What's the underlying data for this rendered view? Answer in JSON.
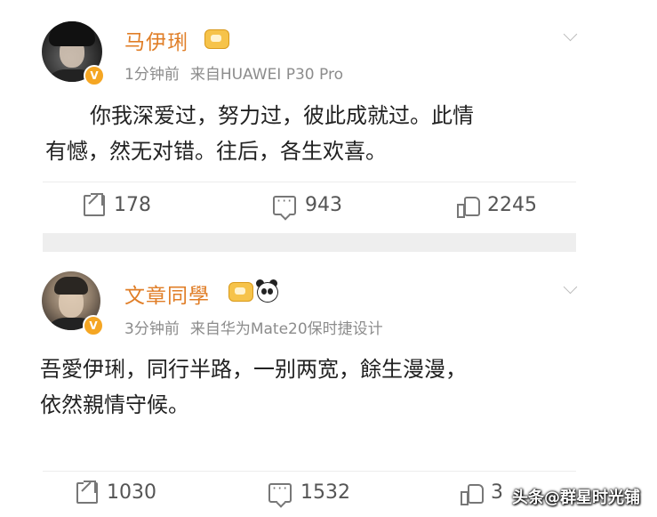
{
  "posts": [
    {
      "username": "马伊琍",
      "time": "1分钟前",
      "source": "来自HUAWEI P30 Pro",
      "content_lines": [
        "你我深爱过，努力过，彼此成就过。此情",
        "有憾，然无对错。往后，各生欢喜。"
      ],
      "reposts": "178",
      "comments": "943",
      "likes": "2245",
      "badge": "V"
    },
    {
      "username": "文章同學",
      "time": "3分钟前",
      "source": "来自华为Mate20保时捷设计",
      "content_lines": [
        "吾愛伊琍，同行半路，一别两宽，餘生漫漫，",
        "依然親情守候。"
      ],
      "reposts": "1030",
      "comments": "1532",
      "likes": "3",
      "badge": "V"
    }
  ],
  "watermark": "头条@群星时光铺",
  "colors": {
    "username": "#e07e27",
    "badge": "#f5a623",
    "meta": "#8c8c8c",
    "separator": "#eeeeee"
  },
  "icons": [
    "share-icon",
    "comment-icon",
    "like-icon",
    "chevron-down-icon",
    "crown-icon",
    "panda-icon"
  ]
}
